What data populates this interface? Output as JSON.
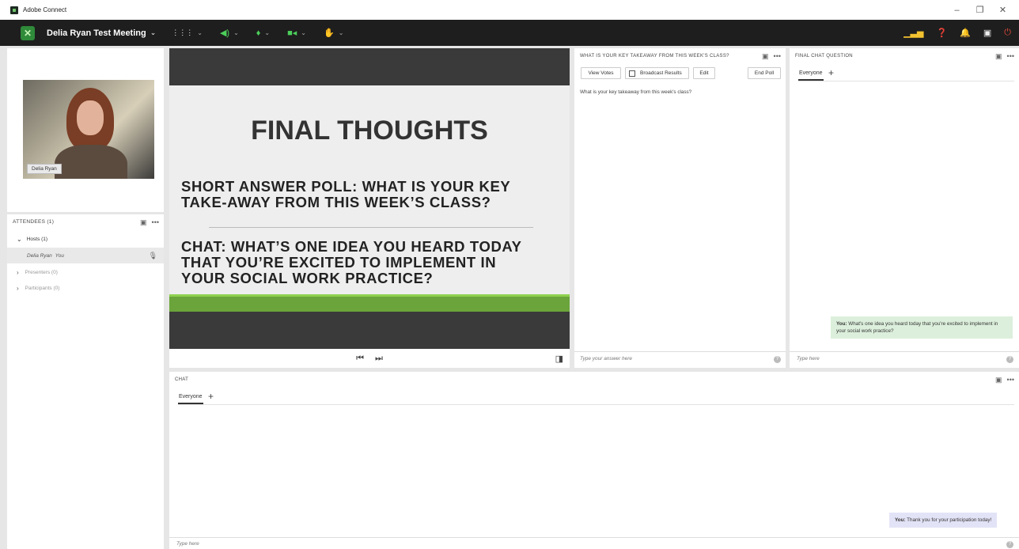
{
  "window": {
    "title": "Adobe Connect",
    "controls": [
      "–",
      "❐",
      "✕"
    ]
  },
  "menubar": {
    "meeting_title": "Delia Ryan Test Meeting",
    "chevron": "⌄",
    "tools": [
      {
        "name": "layouts-icon",
        "glyph": "⋮⋮⋮",
        "color": "#ffffff"
      },
      {
        "name": "speaker-icon",
        "glyph": "◀)",
        "color": "#4ccf5a"
      },
      {
        "name": "microphone-icon",
        "glyph": "🎙",
        "color": "#4ccf5a"
      },
      {
        "name": "camera-icon",
        "glyph": "■◀",
        "color": "#4ccf5a"
      },
      {
        "name": "raise-hand-icon",
        "glyph": "✋",
        "color": "#ffffff"
      }
    ]
  },
  "video": {
    "name": "Delia Ryan"
  },
  "attendees": {
    "title": "ATTENDEES (1)",
    "hosts": "Hosts (1)",
    "host_name": "Delia Ryan",
    "host_tag": "You",
    "presenters": "Presenters (0)",
    "participants": "Participants (0)"
  },
  "slide": {
    "title": "FINAL THOUGHTS",
    "point1": [
      "SHORT ANSWER POLL: WHAT IS YOUR KEY",
      "TAKE-AWAY FROM THIS WEEK’S CLASS?"
    ],
    "point2": [
      "CHAT: WHAT’S ONE IDEA YOU HEARD TODAY",
      "THAT YOU’RE EXCITED TO IMPLEMENT IN",
      "YOUR SOCIAL WORK PRACTICE?"
    ]
  },
  "poll": {
    "title": "WHAT IS YOUR KEY TAKEAWAY FROM THIS WEEK'S CLASS?",
    "view_votes": "View Votes",
    "broadcast": "Broadcast Results",
    "edit": "Edit",
    "end_poll": "End Poll",
    "question": "What is your key takeaway from this week's class?",
    "placeholder": "Type your answer here"
  },
  "final_chat": {
    "title": "FINAL CHAT QUESTION",
    "tab": "Everyone",
    "message_author": "You:",
    "message": "What's one idea you heard today that you're excited to implement in your social work practice?",
    "placeholder": "Type here"
  },
  "chat": {
    "title": "CHAT",
    "tab": "Everyone",
    "message_author": "You:",
    "message": "Thank you for your participation today!",
    "placeholder": "Type here"
  },
  "colors": {
    "menubar": "#1e1e1e",
    "accent_green": "#6ba43a",
    "own_bubble_green": "#dcefdc",
    "own_bubble_lilac": "#e3e3f7"
  }
}
